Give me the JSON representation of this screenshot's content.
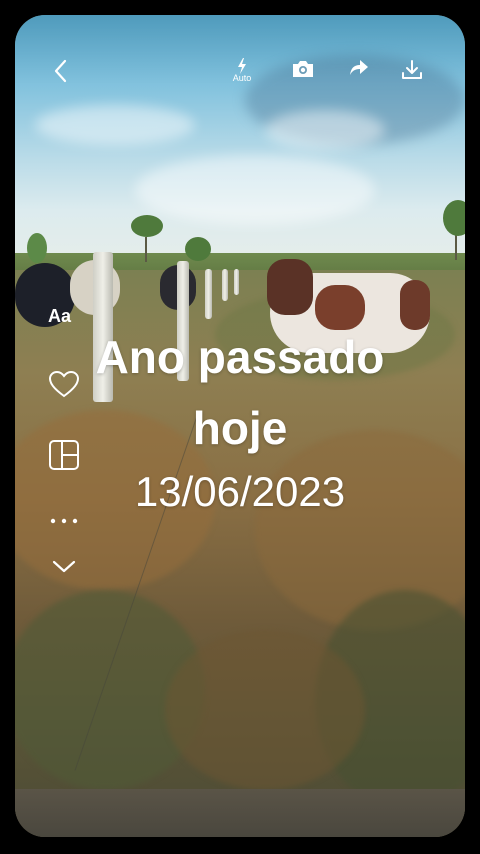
{
  "toolbar": {
    "back_icon": "chevron-left-icon",
    "flash_icon": "flash-auto-icon",
    "flash_label": "Auto",
    "camera_icon": "camera-icon",
    "share_icon": "share-arrow-icon",
    "download_icon": "download-icon"
  },
  "side_controls": {
    "text_style_label": "Aa",
    "heart_icon": "heart-icon",
    "layout_icon": "layout-grid-icon",
    "more_icon": "more-dots-icon",
    "collapse_icon": "chevron-down-icon"
  },
  "overlay": {
    "line1": "Ano passado",
    "line2": "hoje",
    "date": "13/06/2023"
  }
}
